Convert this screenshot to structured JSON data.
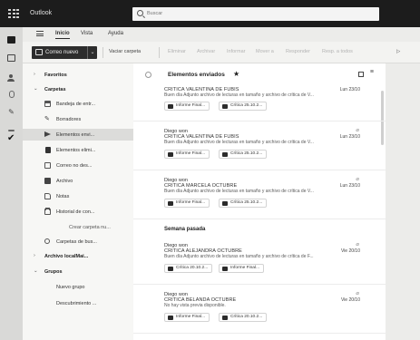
{
  "app": {
    "name": "Outlook"
  },
  "search": {
    "placeholder": "Buscar"
  },
  "ribbon_tabs": [
    "Inicio",
    "Vista",
    "Ayuda"
  ],
  "ribbon": {
    "new_mail": "Correo nuevo",
    "mark_read": "Vaciar carpeta",
    "dim_items": [
      "Eliminar",
      "Archivar",
      "Informar",
      "Mover a",
      "Responder",
      "Resp. a todos"
    ]
  },
  "folders": {
    "favorites": "Favoritos",
    "folders": "Carpetas",
    "items": [
      {
        "label": "Bandeja de entr...",
        "icon": "inbox-icon"
      },
      {
        "label": "Borradores",
        "icon": "draft-icon"
      },
      {
        "label": "Elementos envi...",
        "icon": "send-icon"
      },
      {
        "label": "Elementos elimi...",
        "icon": "trash-icon"
      },
      {
        "label": "Correo no des...",
        "icon": "junk-icon"
      },
      {
        "label": "Archivo",
        "icon": "archive-icon"
      },
      {
        "label": "Notas",
        "icon": "note-icon"
      },
      {
        "label": "Historial de con...",
        "icon": "folder-icon"
      }
    ],
    "create_folder": "Crear carpeta nu...",
    "search_folders": "Carpetas de bus...",
    "local_archive": "Archivo localMai...",
    "groups": "Grupos",
    "new_group": "Nuevo grupo",
    "discover_groups": "Descubrimiento ..."
  },
  "list": {
    "title": "Elementos enviados",
    "section_last_week": "Semana pasada",
    "messages": [
      {
        "from": "",
        "subject": "CRITICA VALENTINA DE FUBIS",
        "date": "Lun 23/10",
        "preview": "Buen día Adjunto archivo de lecturas en tamaño y archivo de crítica de V...",
        "chips": [
          "Informe Final...",
          "Crítica 25.10.2..."
        ]
      },
      {
        "from": "Diego won",
        "subject": "CRITICA VALENTINA DE FUBIS",
        "date": "Lun 23/10",
        "preview": "Buen día Adjunto archivo de lecturas en tamaño y archivo de crítica de V...",
        "chips": [
          "Informe Final...",
          "Crítica 25.10.2..."
        ]
      },
      {
        "from": "Diego won",
        "subject": "CRITICA MARCELA OCTUBRE",
        "date": "Lun 23/10",
        "preview": "Buen día Adjunto archivo de lecturas en tamaño y archivo de crítica de V...",
        "chips": [
          "Informe Final...",
          "Crítica 25.10.2..."
        ]
      },
      {
        "from": "Diego won",
        "subject": "CRITICA ALEJANDRA OCTUBRE",
        "date": "Vie 20/10",
        "preview": "Buen día Adjunto archivo de lecturas en tamaño y archivo de crítica de F...",
        "chips": [
          "Crítica 20.10.2...",
          "Informe Final..."
        ]
      },
      {
        "from": "Diego won",
        "subject": "CRITICA BELANDA OCTUBRE",
        "date": "Vie 20/10",
        "preview": "No hay vista previa disponible.",
        "chips": [
          "Informe Final...",
          "Crítica 20.10.2..."
        ]
      }
    ]
  }
}
